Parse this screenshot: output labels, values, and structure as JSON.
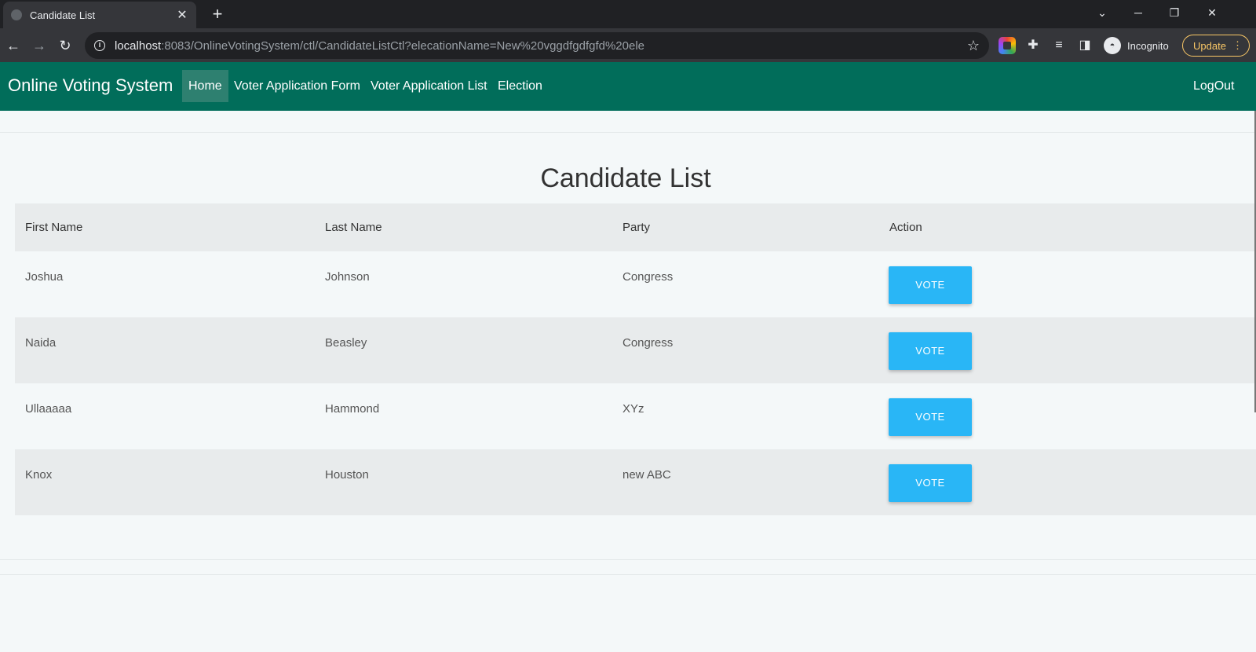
{
  "browser": {
    "tab_title": "Candidate List",
    "url_host": "localhost",
    "url_rest": ":8083/OnlineVotingSystem/ctl/CandidateListCtl?elecationName=New%20vggdfgdfgfd%20ele",
    "profile_label": "Incognito",
    "update_label": "Update"
  },
  "nav": {
    "brand": "Online Voting System",
    "links": [
      "Home",
      "Voter Application Form",
      "Voter Application List",
      "Election"
    ],
    "active": "Home",
    "logout": "LogOut"
  },
  "page": {
    "title": "Candidate List"
  },
  "table": {
    "headers": [
      "First Name",
      "Last Name",
      "Party",
      "Action"
    ],
    "rows": [
      {
        "first": "Joshua",
        "last": "Johnson",
        "party": "Congress",
        "action": "VOTE"
      },
      {
        "first": "Naida",
        "last": "Beasley",
        "party": "Congress",
        "action": "VOTE"
      },
      {
        "first": "Ullaaaaa",
        "last": "Hammond",
        "party": "XYz",
        "action": "VOTE"
      },
      {
        "first": "Knox",
        "last": "Houston",
        "party": "new ABC",
        "action": "VOTE"
      }
    ]
  },
  "colors": {
    "nav_bg": "#016d5a",
    "vote_button": "#29b6f6",
    "page_bg": "#f4f8f9"
  }
}
